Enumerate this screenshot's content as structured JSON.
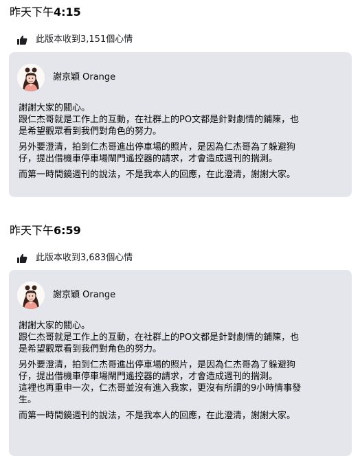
{
  "versions": [
    {
      "timestamp_prefix": "昨天下午",
      "timestamp_time": "4:15",
      "likes_text": "此版本收到3,151個心情",
      "author": "謝京穎 Orange",
      "paragraphs": [
        [
          "謝謝大家的關心。",
          "跟仁杰哥就是工作上的互動，在社群上的PO文都是針對劇情的鋪陳，也",
          "是希望觀眾看到我們對角色的努力。"
        ],
        [
          "另外要澄清，拍到仁杰哥進出停車場的照片，是因為仁杰哥為了躲避狗",
          "仔，提出借機車停車場閘門遙控器的請求，才會造成週刊的揣測。"
        ],
        [
          "而第一時間鏡週刊的說法，不是我本人的回應，在此澄清，謝謝大家。"
        ]
      ]
    },
    {
      "timestamp_prefix": "昨天下午",
      "timestamp_time": "6:59",
      "likes_text": "此版本收到3,683個心情",
      "author": "謝京穎 Orange",
      "paragraphs": [
        [
          "謝謝大家的關心。",
          "跟仁杰哥就是工作上的互動，在社群上的PO文都是針對劇情的鋪陳，也",
          "是希望觀眾看到我們對角色的努力。"
        ],
        [
          "另外要澄清，拍到仁杰哥進出停車場的照片，是因為仁杰哥為了躲避狗",
          "仔，提出借機車停車場閘門遙控器的請求，才會造成週刊的揣測。",
          "這裡也再重申一次，仁杰哥並沒有進入我家，更沒有所謂的9小時情事發",
          "生。"
        ],
        [
          "而第一時間鏡週刊的說法，不是我本人的回應，在此澄清，謝謝大家。"
        ]
      ]
    }
  ],
  "colors": {
    "card_background": "#e4e6eb",
    "text": "#050505",
    "like_icon": "#1c1e21"
  },
  "icons": {
    "like": "thumbs-up-icon"
  }
}
